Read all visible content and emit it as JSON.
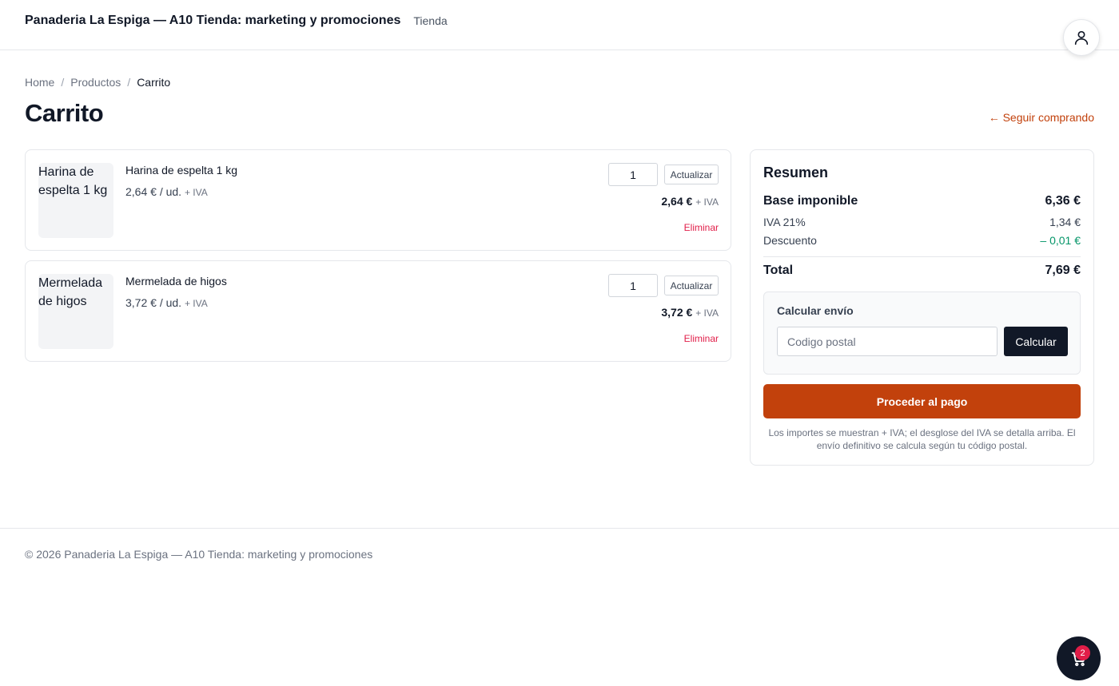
{
  "header": {
    "brand": "Panaderia La Espiga — A10 Tienda: marketing y promociones",
    "nav_link": "Tienda",
    "account_icon": "user-icon"
  },
  "breadcrumb": {
    "items": [
      "Home",
      "Productos",
      "Carrito"
    ],
    "separator": "/"
  },
  "page": {
    "title": "Carrito",
    "continue_link": "← Seguir comprando"
  },
  "cart_items": [
    {
      "image_alt": "Harina de espelta 1 kg",
      "name": "Harina de espelta 1 kg",
      "unit_price": "2,64 € / ud.",
      "iva_suffix": "+ IVA",
      "quantity": "1",
      "update_label": "Actualizar",
      "line_total": "2,64 €",
      "remove_label": "Eliminar"
    },
    {
      "image_alt": "Mermelada de higos",
      "name": "Mermelada de higos",
      "unit_price": "3,72 € / ud.",
      "iva_suffix": "+ IVA",
      "quantity": "1",
      "update_label": "Actualizar",
      "line_total": "3,72 €",
      "remove_label": "Eliminar"
    }
  ],
  "summary": {
    "title": "Resumen",
    "base_label": "Base imponible",
    "base_value": "6,36 €",
    "iva_label": "IVA 21%",
    "iva_value": "1,34 €",
    "discount_label": "Descuento",
    "discount_value": "– 0,01 €",
    "total_label": "Total",
    "total_value": "7,69 €",
    "shipping": {
      "title": "Calcular envío",
      "zip_placeholder": "Codigo postal",
      "zip_value": "",
      "calc_label": "Calcular"
    },
    "checkout_label": "Proceder al pago",
    "note": "Los importes se muestran + IVA; el desglose del IVA se detalla arriba. El envío definitivo se calcula según tu código postal."
  },
  "footer": {
    "text": "© 2026 Panaderia La Espiga — A10 Tienda: marketing y promociones"
  },
  "cart_fab": {
    "icon": "cart-icon",
    "badge_count": "2"
  },
  "colors": {
    "accent": "#c2410c",
    "danger": "#e11d48",
    "success": "#059669",
    "dark": "#111827"
  }
}
